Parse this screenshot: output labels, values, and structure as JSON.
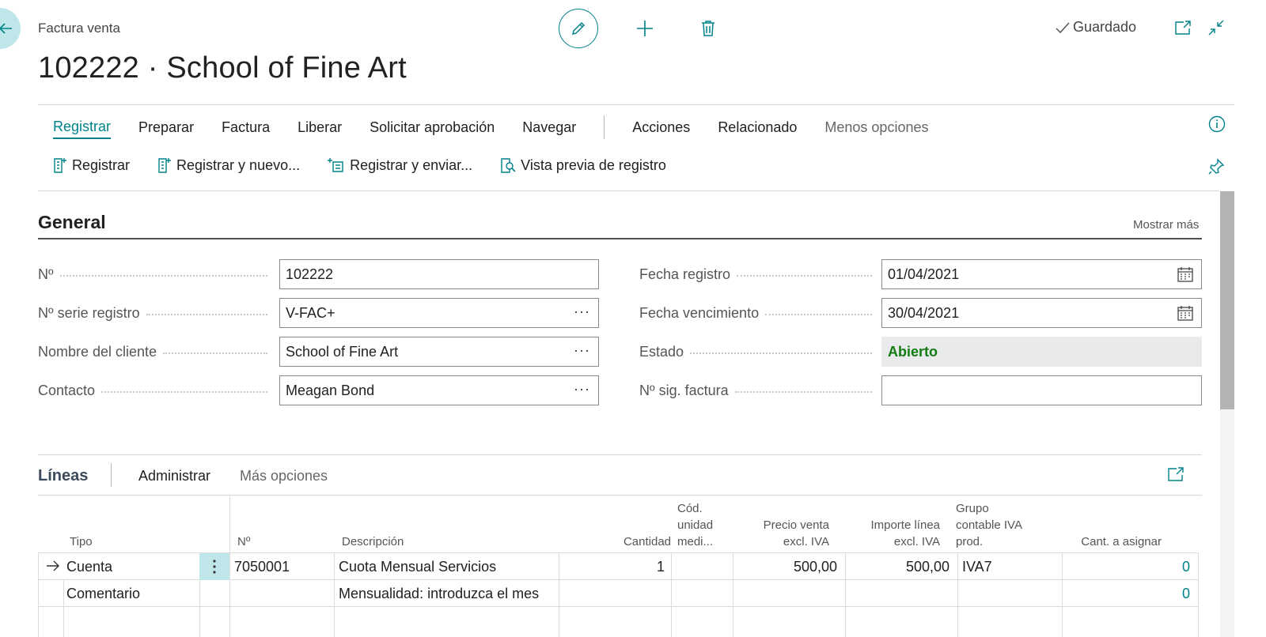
{
  "header": {
    "page_type": "Factura venta",
    "title": "102222 · School of Fine Art",
    "saved_label": "Guardado"
  },
  "menu": {
    "tabs": [
      {
        "label": "Registrar"
      },
      {
        "label": "Preparar"
      },
      {
        "label": "Factura"
      },
      {
        "label": "Liberar"
      },
      {
        "label": "Solicitar aprobación"
      },
      {
        "label": "Navegar"
      },
      {
        "label": "Acciones"
      },
      {
        "label": "Relacionado"
      },
      {
        "label": "Menos opciones"
      }
    ],
    "actions": [
      {
        "label": "Registrar"
      },
      {
        "label": "Registrar y nuevo..."
      },
      {
        "label": "Registrar y enviar..."
      },
      {
        "label": "Vista previa de registro"
      }
    ]
  },
  "general": {
    "title": "General",
    "show_more": "Mostrar más",
    "fields_left": [
      {
        "label": "Nº",
        "value": "102222"
      },
      {
        "label": "Nº serie registro",
        "value": "V-FAC+"
      },
      {
        "label": "Nombre del cliente",
        "value": "School of Fine Art"
      },
      {
        "label": "Contacto",
        "value": "Meagan Bond"
      }
    ],
    "fields_right": [
      {
        "label": "Fecha registro",
        "value": "01/04/2021"
      },
      {
        "label": "Fecha vencimiento",
        "value": "30/04/2021"
      },
      {
        "label": "Estado",
        "value": "Abierto"
      },
      {
        "label": "Nº sig. factura",
        "value": ""
      }
    ],
    "ellipsis": "···"
  },
  "lines": {
    "title": "Líneas",
    "manage_label": "Administrar",
    "more_label": "Más opciones",
    "columns": {
      "tipo": "Tipo",
      "no": "Nº",
      "descripcion": "Descripción",
      "cantidad": "Cantidad",
      "cod_unidad": [
        "Cód.",
        "unidad",
        "medi..."
      ],
      "precio_venta": [
        "Precio venta",
        "excl. IVA"
      ],
      "importe_linea": [
        "Importe línea",
        "excl. IVA"
      ],
      "grupo_iva": [
        "Grupo",
        "contable IVA",
        "prod."
      ],
      "cant_asignar": "Cant. a asignar"
    },
    "rows": [
      {
        "tipo": "Cuenta",
        "no": "7050001",
        "descripcion": "Cuota Mensual Servicios",
        "cantidad": "1",
        "cod_unidad": "",
        "precio": "500,00",
        "importe": "500,00",
        "grupo_iva": "IVA7",
        "cant_asignar": "0"
      },
      {
        "tipo": "Comentario",
        "no": "",
        "descripcion": "Mensualidad: introduzca el mes",
        "cantidad": "",
        "cod_unidad": "",
        "precio": "",
        "importe": "",
        "grupo_iva": "",
        "cant_asignar": "0"
      }
    ]
  },
  "colors": {
    "accent": "#00828a",
    "status_open": "#107c10"
  }
}
